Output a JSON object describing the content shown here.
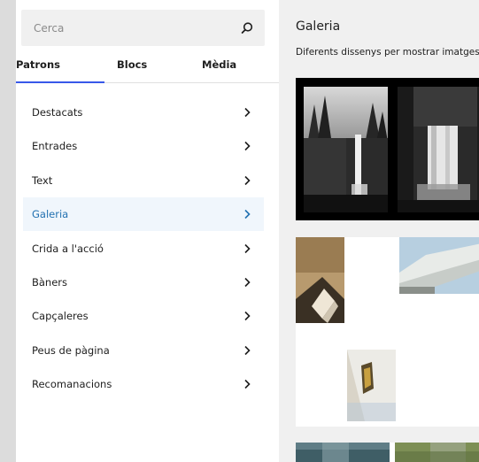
{
  "search": {
    "placeholder": "Cerca"
  },
  "tabs": [
    {
      "label": "Patrons",
      "selected": true
    },
    {
      "label": "Blocs",
      "selected": false
    },
    {
      "label": "Mèdia",
      "selected": false
    }
  ],
  "categories": [
    {
      "label": "Destacats",
      "active": false
    },
    {
      "label": "Entrades",
      "active": false
    },
    {
      "label": "Text",
      "active": false
    },
    {
      "label": "Galeria",
      "active": true
    },
    {
      "label": "Crida a l'acció",
      "active": false
    },
    {
      "label": "Bàners",
      "active": false
    },
    {
      "label": "Capçaleres",
      "active": false
    },
    {
      "label": "Peus de pàgina",
      "active": false
    },
    {
      "label": "Recomanacions",
      "active": false
    }
  ],
  "main": {
    "title": "Galeria",
    "description": "Diferents dissenys per mostrar imatges."
  },
  "colors": {
    "accent": "#3858e9",
    "active_text": "#2271b1",
    "active_bg": "#f0f6fc"
  },
  "icons": {
    "search": "search-icon",
    "chevron": "chevron-right-icon"
  }
}
